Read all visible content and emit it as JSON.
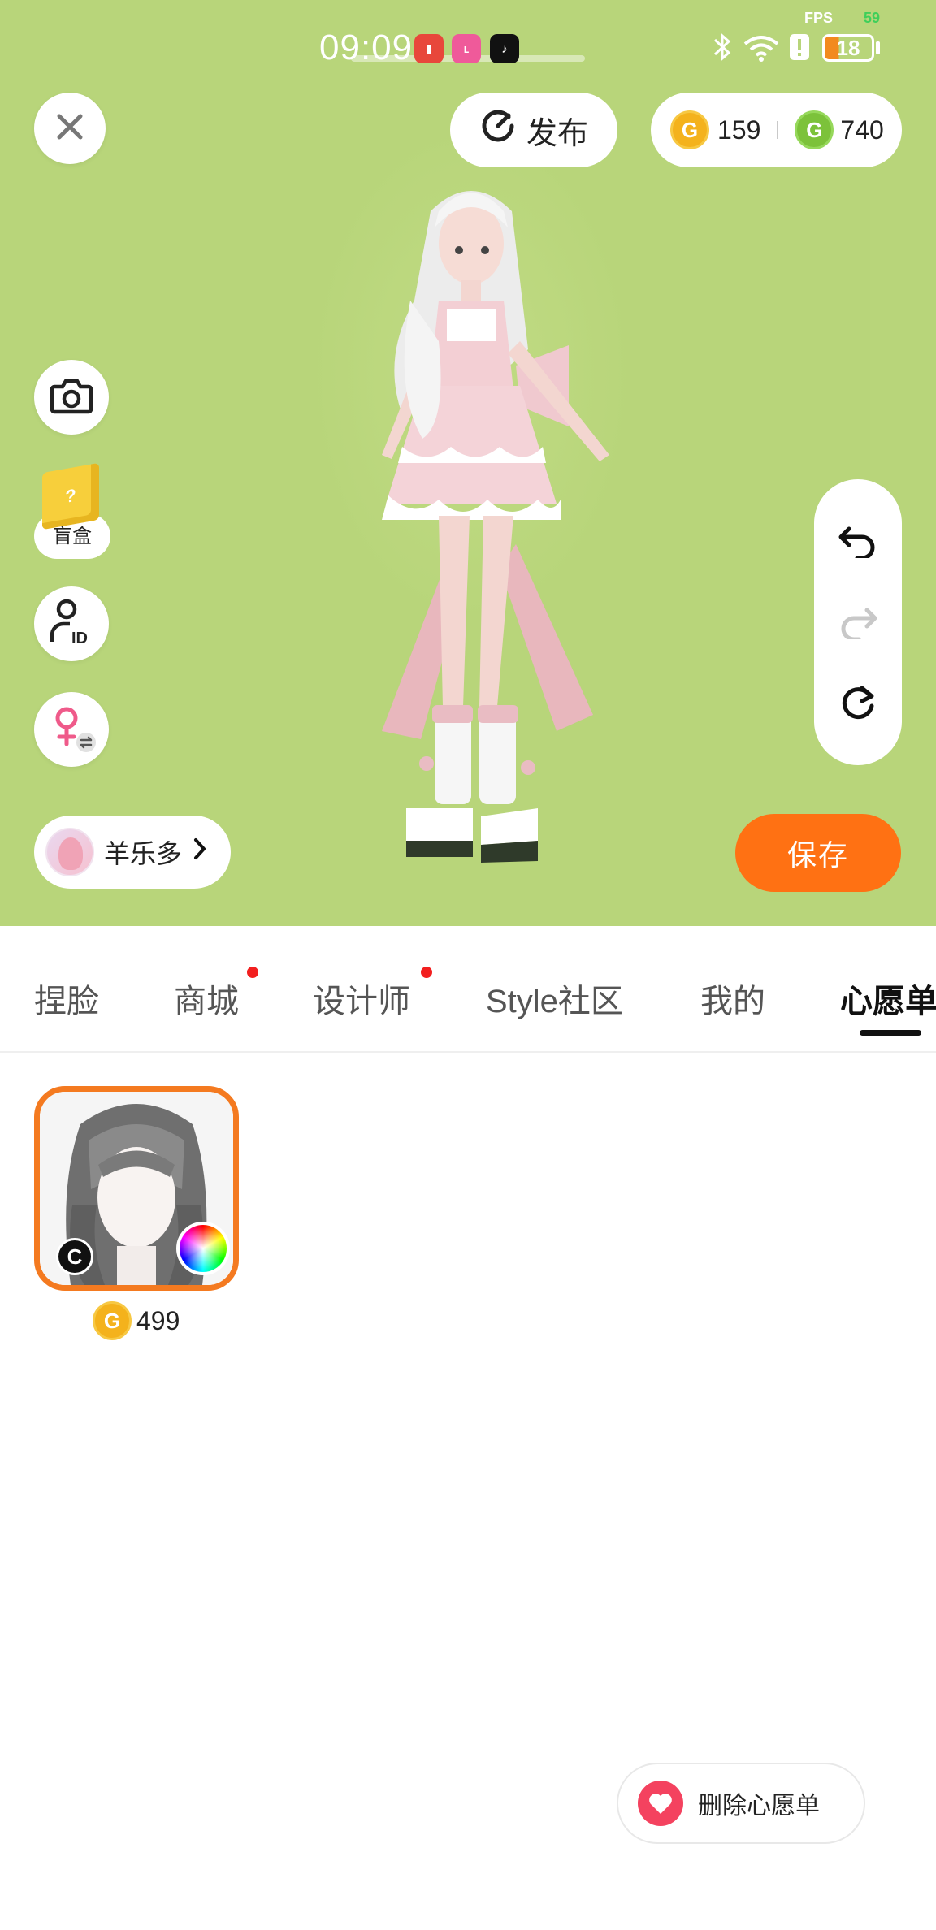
{
  "status_bar": {
    "time": "09:09",
    "fps_label": "FPS",
    "fps_value": "59",
    "battery": "18",
    "network": "6"
  },
  "top_bar": {
    "publish_label": "发布",
    "gold_coins": "159",
    "green_coins": "740"
  },
  "left_tools": {
    "blindbox_label": "盲盒"
  },
  "designer": {
    "name": "羊乐多"
  },
  "save_label": "保存",
  "tabs": [
    {
      "label": "捏脸",
      "dot": false,
      "active": false
    },
    {
      "label": "商城",
      "dot": true,
      "active": false
    },
    {
      "label": "设计师",
      "dot": true,
      "active": false
    },
    {
      "label": "Style社区",
      "dot": false,
      "active": false
    },
    {
      "label": "我的",
      "dot": false,
      "active": false
    },
    {
      "label": "心愿单",
      "dot": false,
      "active": true
    }
  ],
  "wishlist": {
    "items": [
      {
        "price": "499",
        "creator_badge": "C"
      }
    ],
    "delete_label": "删除心愿单"
  },
  "colors": {
    "stage_bg": "#b8d57a",
    "accent_orange": "#ff7113",
    "tab_dot": "#f21f1f",
    "heart": "#f4425f"
  },
  "icons": [
    "close-icon",
    "publish-icon",
    "gold-coin-icon",
    "green-coin-icon",
    "camera-icon",
    "blindbox-icon",
    "avatar-id-icon",
    "gender-switch-icon",
    "undo-icon",
    "redo-icon",
    "reset-icon",
    "chevron-right-icon",
    "color-wheel-icon",
    "heart-icon"
  ]
}
